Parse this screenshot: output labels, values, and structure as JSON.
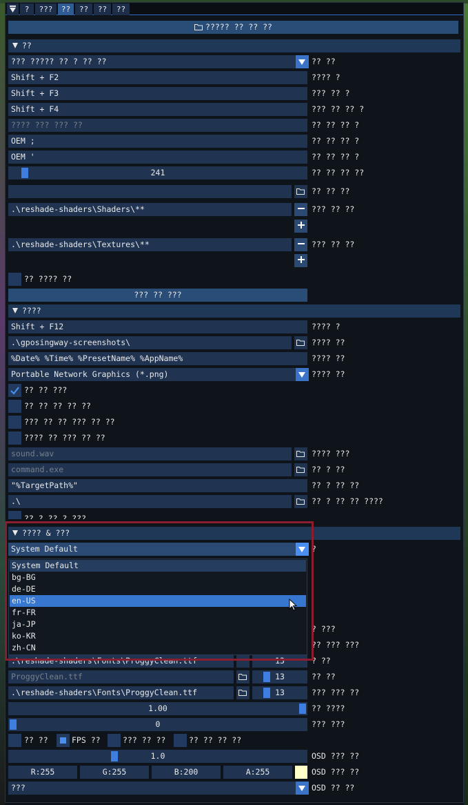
{
  "tabs": [
    "?",
    "???",
    "??",
    "??",
    "??",
    "??"
  ],
  "top_button": "????? ?? ?? ??",
  "general": {
    "header": "??",
    "items": [
      {
        "value": "??? ????? ?? ? ?? ??",
        "label": "?? ??"
      },
      {
        "value": "Shift + F2",
        "label": "???? ?"
      },
      {
        "value": "Shift + F3",
        "label": "??? ?? ?"
      },
      {
        "value": "Shift + F4",
        "label": "??? ?? ?? ?"
      },
      {
        "value": "???? ??? ??? ??",
        "label": "?? ?? ?? ?"
      },
      {
        "value": "OEM ;",
        "label": "?? ?? ?? ?"
      },
      {
        "value": "OEM '",
        "label": "?? ?? ?? ?"
      }
    ],
    "slider": {
      "value": "241",
      "fraction": 0.04,
      "label": "?? ?? ?? ??"
    },
    "path_empty_label": "?? ?? ??",
    "shader_path": {
      "value": ".\\reshade-shaders\\Shaders\\**",
      "label": "??? ?? ??"
    },
    "texture_path": {
      "value": ".\\reshade-shaders\\Textures\\**",
      "label": "??? ?? ??"
    },
    "checkbox_label": "?? ???? ??",
    "center_button": "??? ?? ???"
  },
  "screenshot": {
    "header": "????",
    "key": {
      "value": "Shift + F12",
      "label": "???? ?"
    },
    "path": {
      "value": ".\\gposingway-screenshots\\",
      "label": "???? ??"
    },
    "name": {
      "value": "%Date% %Time% %PresetName% %AppName%",
      "label": "???? ??"
    },
    "format": {
      "value": "Portable Network Graphics (*.png)",
      "label": "???? ??"
    },
    "checks": [
      {
        "label": "?? ?? ???",
        "checked": true
      },
      {
        "label": "?? ?? ?? ?? ??",
        "checked": false
      },
      {
        "label": "??? ?? ?? ??? ?? ??",
        "checked": false
      },
      {
        "label": "???? ?? ??? ?? ??",
        "checked": false
      }
    ],
    "sound": {
      "value": "sound.wav",
      "label": "???? ???"
    },
    "command": {
      "value": "command.exe",
      "label": "?? ? ??"
    },
    "target": {
      "value": "\"%TargetPath%\"",
      "label": "?? ? ?? ??"
    },
    "workdir": {
      "value": ".\\",
      "label": "?? ? ?? ?? ????"
    },
    "partial_check": "?? ? ?? ? ???"
  },
  "ui": {
    "header": "???? & ???",
    "language": {
      "value": "System Default",
      "label": "?"
    },
    "language_options": [
      "System Default",
      "bg-BG",
      "de-DE",
      "en-US",
      "fr-FR",
      "ja-JP",
      "ko-KR",
      "zh-CN"
    ],
    "behind_text": "???? ?? ??",
    "behind_text2": "?? ?? ??",
    "behind_text3": "?? ?? ?? ??",
    "behind_text4": "?? ?? ?? ?? ?? ???",
    "hidden_labels": [
      "? ???",
      "?? ??? ???",
      "? ??"
    ],
    "partial_font_path": ".\\reshade-shaders\\Fonts\\ProggyClean.ttf",
    "partial_font_size": "13",
    "font1": {
      "value": "ProggyClean.ttf",
      "size": "13",
      "label": "?? ??"
    },
    "font2": {
      "value": ".\\reshade-shaders\\Fonts\\ProggyClean.ttf",
      "size": "13",
      "label": "??? ??? ??"
    },
    "scale": {
      "value": "1.00",
      "fraction": 1.0,
      "label": "?? ????"
    },
    "rounding": {
      "value": "0",
      "fraction": 0.0,
      "label": "??? ???"
    },
    "fps_checks": [
      {
        "label": "?? ??",
        "checked": false
      },
      {
        "label": "FPS ??",
        "checked": true
      },
      {
        "label": "??? ?? ??",
        "checked": false
      },
      {
        "label": "?? ?? ?? ??",
        "checked": false
      }
    ],
    "osd_scale": {
      "value": "1.0",
      "fraction": 0.35,
      "label": "OSD ??? ??"
    },
    "osd_color": {
      "r": "R:255",
      "g": "G:255",
      "b": "B:200",
      "a": "A:255",
      "swatch": "#ffffc8",
      "label": "OSD ??? ??"
    },
    "osd_pos": {
      "value": "???",
      "label": "OSD ?? ??"
    }
  },
  "colors": {
    "accent": "#3d7ee0",
    "frame": "#203452",
    "header": "#1f3858",
    "highlight_box": "#8b1e2e"
  }
}
